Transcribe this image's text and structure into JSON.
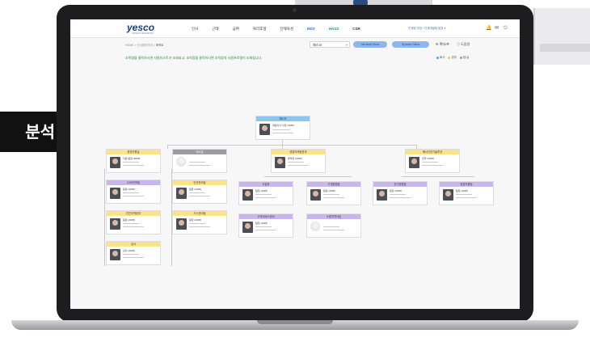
{
  "side_label": "분석",
  "header": {
    "logo": "yesco",
    "logo_sub": "YESCO HOLDINGS",
    "nav": [
      {
        "label": "인사",
        "kind": "normal"
      },
      {
        "label": "근태",
        "kind": "normal"
      },
      {
        "label": "급여",
        "kind": "normal"
      },
      {
        "label": "복리후생",
        "kind": "normal"
      },
      {
        "label": "인재육성",
        "kind": "normal"
      },
      {
        "label": "MSS",
        "kind": "mss"
      },
      {
        "label": "HASS",
        "kind": "hass"
      },
      {
        "label": "CSR",
        "kind": "csr"
      }
    ],
    "user_info": "인재팀 부장 / 인재개발팀 팀장 ▾"
  },
  "toolbar": {
    "breadcrumb_prefix": "HOME > 인사정보관리 >",
    "breadcrumb_current": "조직도",
    "company_select": "예스코",
    "vertical_view": "Vertical View",
    "spread_view": "Spread View",
    "expand_label": "확대/축",
    "help_label": "도움말"
  },
  "notice": "조직명을 클릭하시면 사원리스트가 조회되고, 조직장을 클릭하시면 조직장의 사원프로필이 조회됩니다.",
  "legend": [
    {
      "label": "회사",
      "color": "#5aa0ea"
    },
    {
      "label": "본부",
      "color": "#f2c94c"
    },
    {
      "label": "팀/실",
      "color": "#a58be6"
    }
  ],
  "org": {
    "root": {
      "title": "예스코",
      "person": "대표이사 사장 (2025)"
    },
    "cards": [
      {
        "title": "경영지원실",
        "person": "지원 팀장 (2025)"
      },
      {
        "title": "비서실",
        "person": ""
      },
      {
        "title": "영업마케팅본부",
        "person": "본부장 (2025)"
      },
      {
        "title": "에너지전기솔루션",
        "person": "전무 (2025)"
      },
      {
        "title": "CSR전략팀",
        "person": "팀장 (2025)"
      },
      {
        "title": "안전관리팀",
        "person": "팀장 (2025)"
      },
      {
        "title": "가스관리팀",
        "person": "팀장 (2025)"
      },
      {
        "title": "인천지역본부",
        "person": "팀장 (2025)"
      },
      {
        "title": "사업부",
        "person": "팀장 (2025)"
      },
      {
        "title": "고객서비스센터",
        "person": "팀장 (2025)"
      },
      {
        "title": "기계영업팀",
        "person": "팀장 (2025)"
      },
      {
        "title": "전기영업팀",
        "person": "팀장 (2025)"
      },
      {
        "title": "영업지원팀",
        "person": "팀장 (2025)"
      },
      {
        "title": "노원지역사업",
        "person": ""
      },
      {
        "title": "감사",
        "person": "감사 (2025)"
      }
    ]
  }
}
